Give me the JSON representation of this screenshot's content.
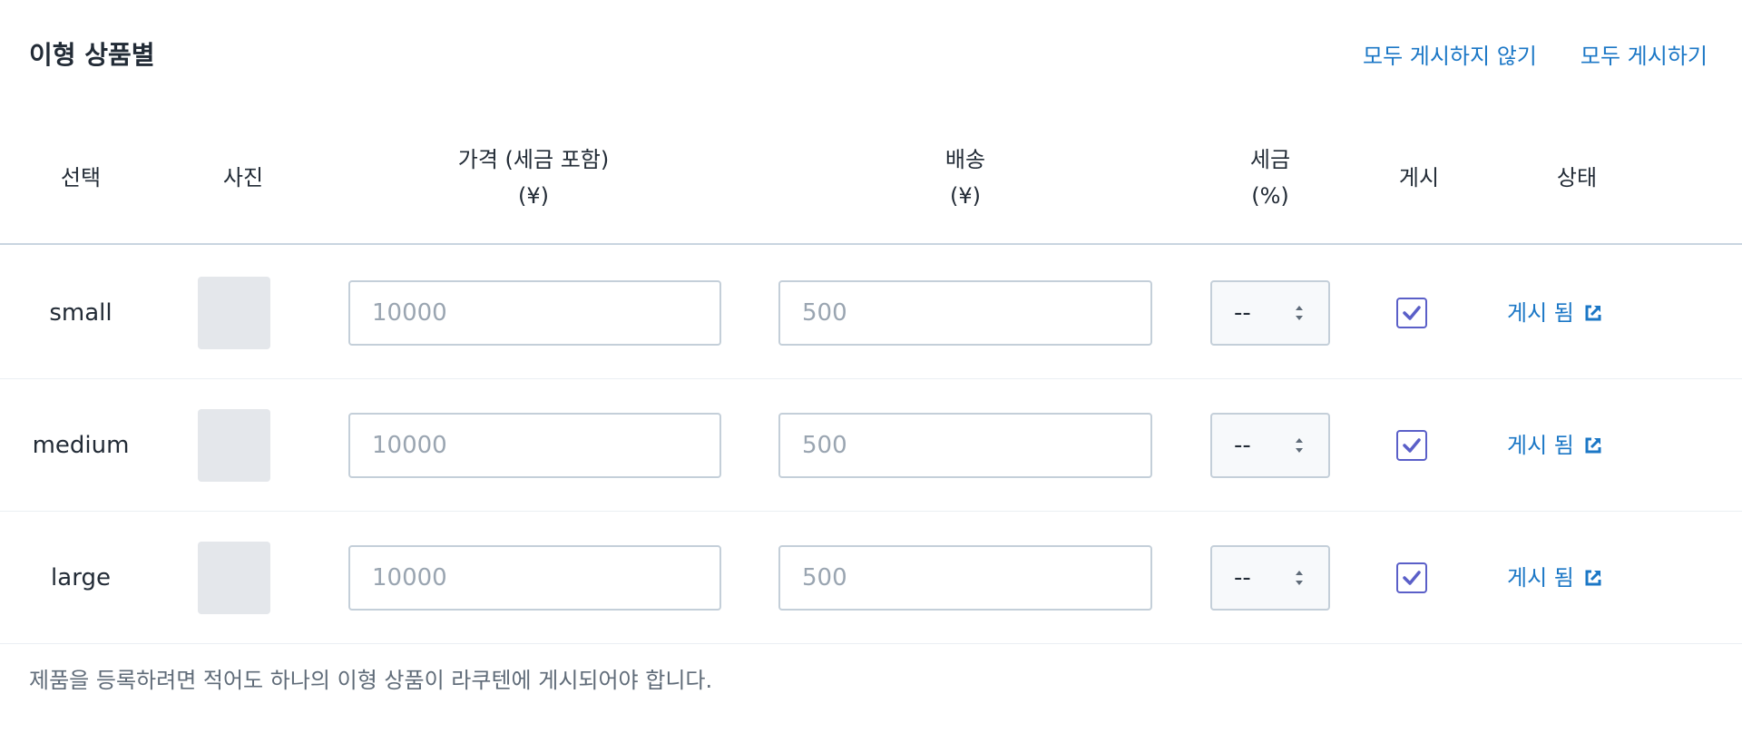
{
  "section": {
    "title": "이형 상품별",
    "actions": {
      "unpublish_all": "모두 게시하지 않기",
      "publish_all": "모두 게시하기"
    }
  },
  "table": {
    "headers": {
      "select": "선택",
      "photo": "사진",
      "price_line1": "가격 (세금 포함)",
      "price_line2": "(¥)",
      "shipping_line1": "배송",
      "shipping_line2": "(¥)",
      "tax_line1": "세금",
      "tax_line2": "(%)",
      "publish": "게시",
      "status": "상태"
    },
    "rows": [
      {
        "variant": "small",
        "price_placeholder": "10000",
        "shipping_placeholder": "500",
        "tax": "--",
        "published": true,
        "status": "게시 됨"
      },
      {
        "variant": "medium",
        "price_placeholder": "10000",
        "shipping_placeholder": "500",
        "tax": "--",
        "published": true,
        "status": "게시 됨"
      },
      {
        "variant": "large",
        "price_placeholder": "10000",
        "shipping_placeholder": "500",
        "tax": "--",
        "published": true,
        "status": "게시 됨"
      }
    ]
  },
  "footnote": "제품을 등록하려면 적어도 하나의 이형 상품이 라쿠텐에 게시되어야 합니다.",
  "colors": {
    "link": "#1b77c6",
    "checkbox": "#5a5fc8",
    "thumb_placeholder": "#e4e7eb"
  },
  "icons": {
    "status_link": "external-link-icon",
    "select_arrows": "sort-arrows-icon",
    "checkbox_mark": "checkmark-icon"
  }
}
